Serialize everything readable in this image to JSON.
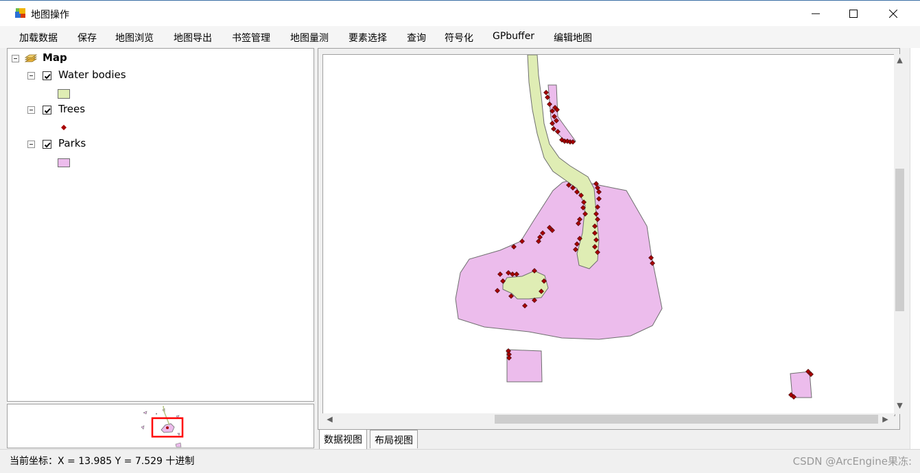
{
  "window": {
    "title": "地图操作",
    "controls": {
      "minimize": "minimize",
      "maximize": "maximize",
      "close": "close"
    }
  },
  "menu": {
    "items": [
      "加载数据",
      "保存",
      "地图浏览",
      "地图导出",
      "书签管理",
      "地图量测",
      "要素选择",
      "查询",
      "符号化",
      "GPbuffer",
      "编辑地图"
    ]
  },
  "toc": {
    "root": "Map",
    "layers": [
      {
        "label": "Water bodies",
        "checked": true,
        "symbol": "polygon",
        "color": "#dfedb4"
      },
      {
        "label": "Trees",
        "checked": true,
        "symbol": "point",
        "color": "#a80000"
      },
      {
        "label": "Parks",
        "checked": true,
        "symbol": "polygon",
        "color": "#ecbcec"
      }
    ]
  },
  "map": {
    "colors": {
      "water": "#dfedb4",
      "park": "#ecbcec",
      "tree": "#a80000",
      "outline": "#6e6e6e"
    }
  },
  "tabs": {
    "data_view": "数据视图",
    "layout_view": "布局视图"
  },
  "status": {
    "coordinates": "当前坐标：X = 13.985 Y = 7.529 十进制"
  },
  "watermark": "CSDN @ArcEngine果冻:"
}
